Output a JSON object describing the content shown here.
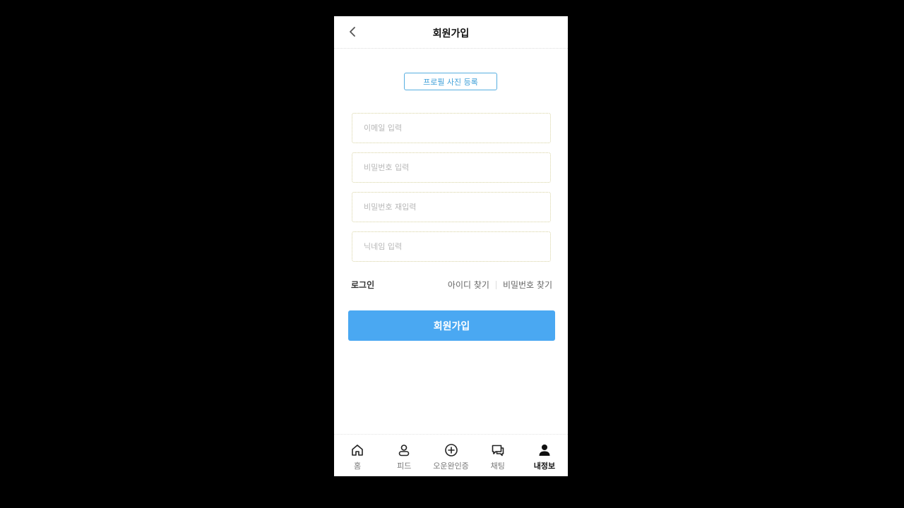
{
  "header": {
    "title": "회원가입",
    "back_icon": "chevron-left-icon"
  },
  "profile": {
    "button_label": "프로필 사진 등록"
  },
  "form": {
    "email_placeholder": "이메일 입력",
    "password_placeholder": "비밀번호 입력",
    "password_confirm_placeholder": "비밀번호 재입력",
    "nickname_placeholder": "닉네임 입력"
  },
  "links": {
    "login": "로그인",
    "find_id": "아이디 찾기",
    "find_password": "비밀번호 찾기"
  },
  "submit": {
    "label": "회원가입"
  },
  "bottom_nav": {
    "items": [
      {
        "label": "홈",
        "icon": "home-icon",
        "active": false
      },
      {
        "label": "피드",
        "icon": "feed-person-icon",
        "active": false
      },
      {
        "label": "오운완인증",
        "icon": "plus-circle-icon",
        "active": false
      },
      {
        "label": "채팅",
        "icon": "chat-icon",
        "active": false
      },
      {
        "label": "내정보",
        "icon": "person-filled-icon",
        "active": true
      }
    ]
  },
  "colors": {
    "accent": "#4aa8f2",
    "profile_border": "#57aee0",
    "background": "#000000"
  }
}
